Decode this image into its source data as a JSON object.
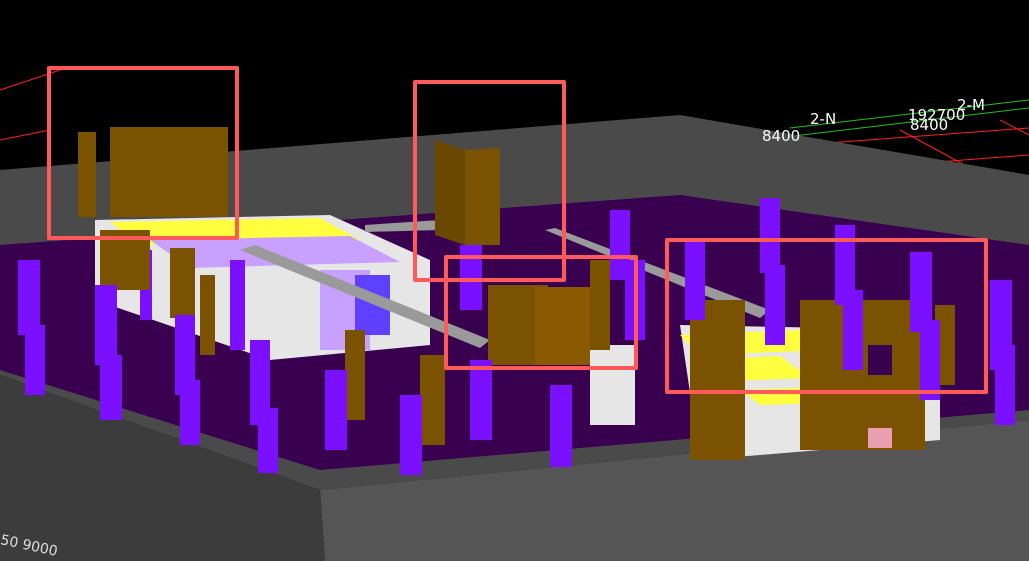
{
  "viewer": {
    "grid_labels": {
      "axis_a": "2-N",
      "axis_b": "2-M",
      "dim_a": "8400",
      "dim_b": "8400",
      "dim_c": "192700",
      "dim_bottom": "50  9000"
    },
    "selection_count": 4,
    "colors": {
      "background": "#000000",
      "slab": "#4a4a4a",
      "floor": "#3a0050",
      "column": "#7a10ff",
      "wall_brown": "#7a5200",
      "wall_white": "#e6e6e6",
      "wall_yellow": "#ffff40",
      "selection": "#ff5a5a",
      "grid_red": "#ff2020",
      "grid_green": "#20c020"
    }
  }
}
